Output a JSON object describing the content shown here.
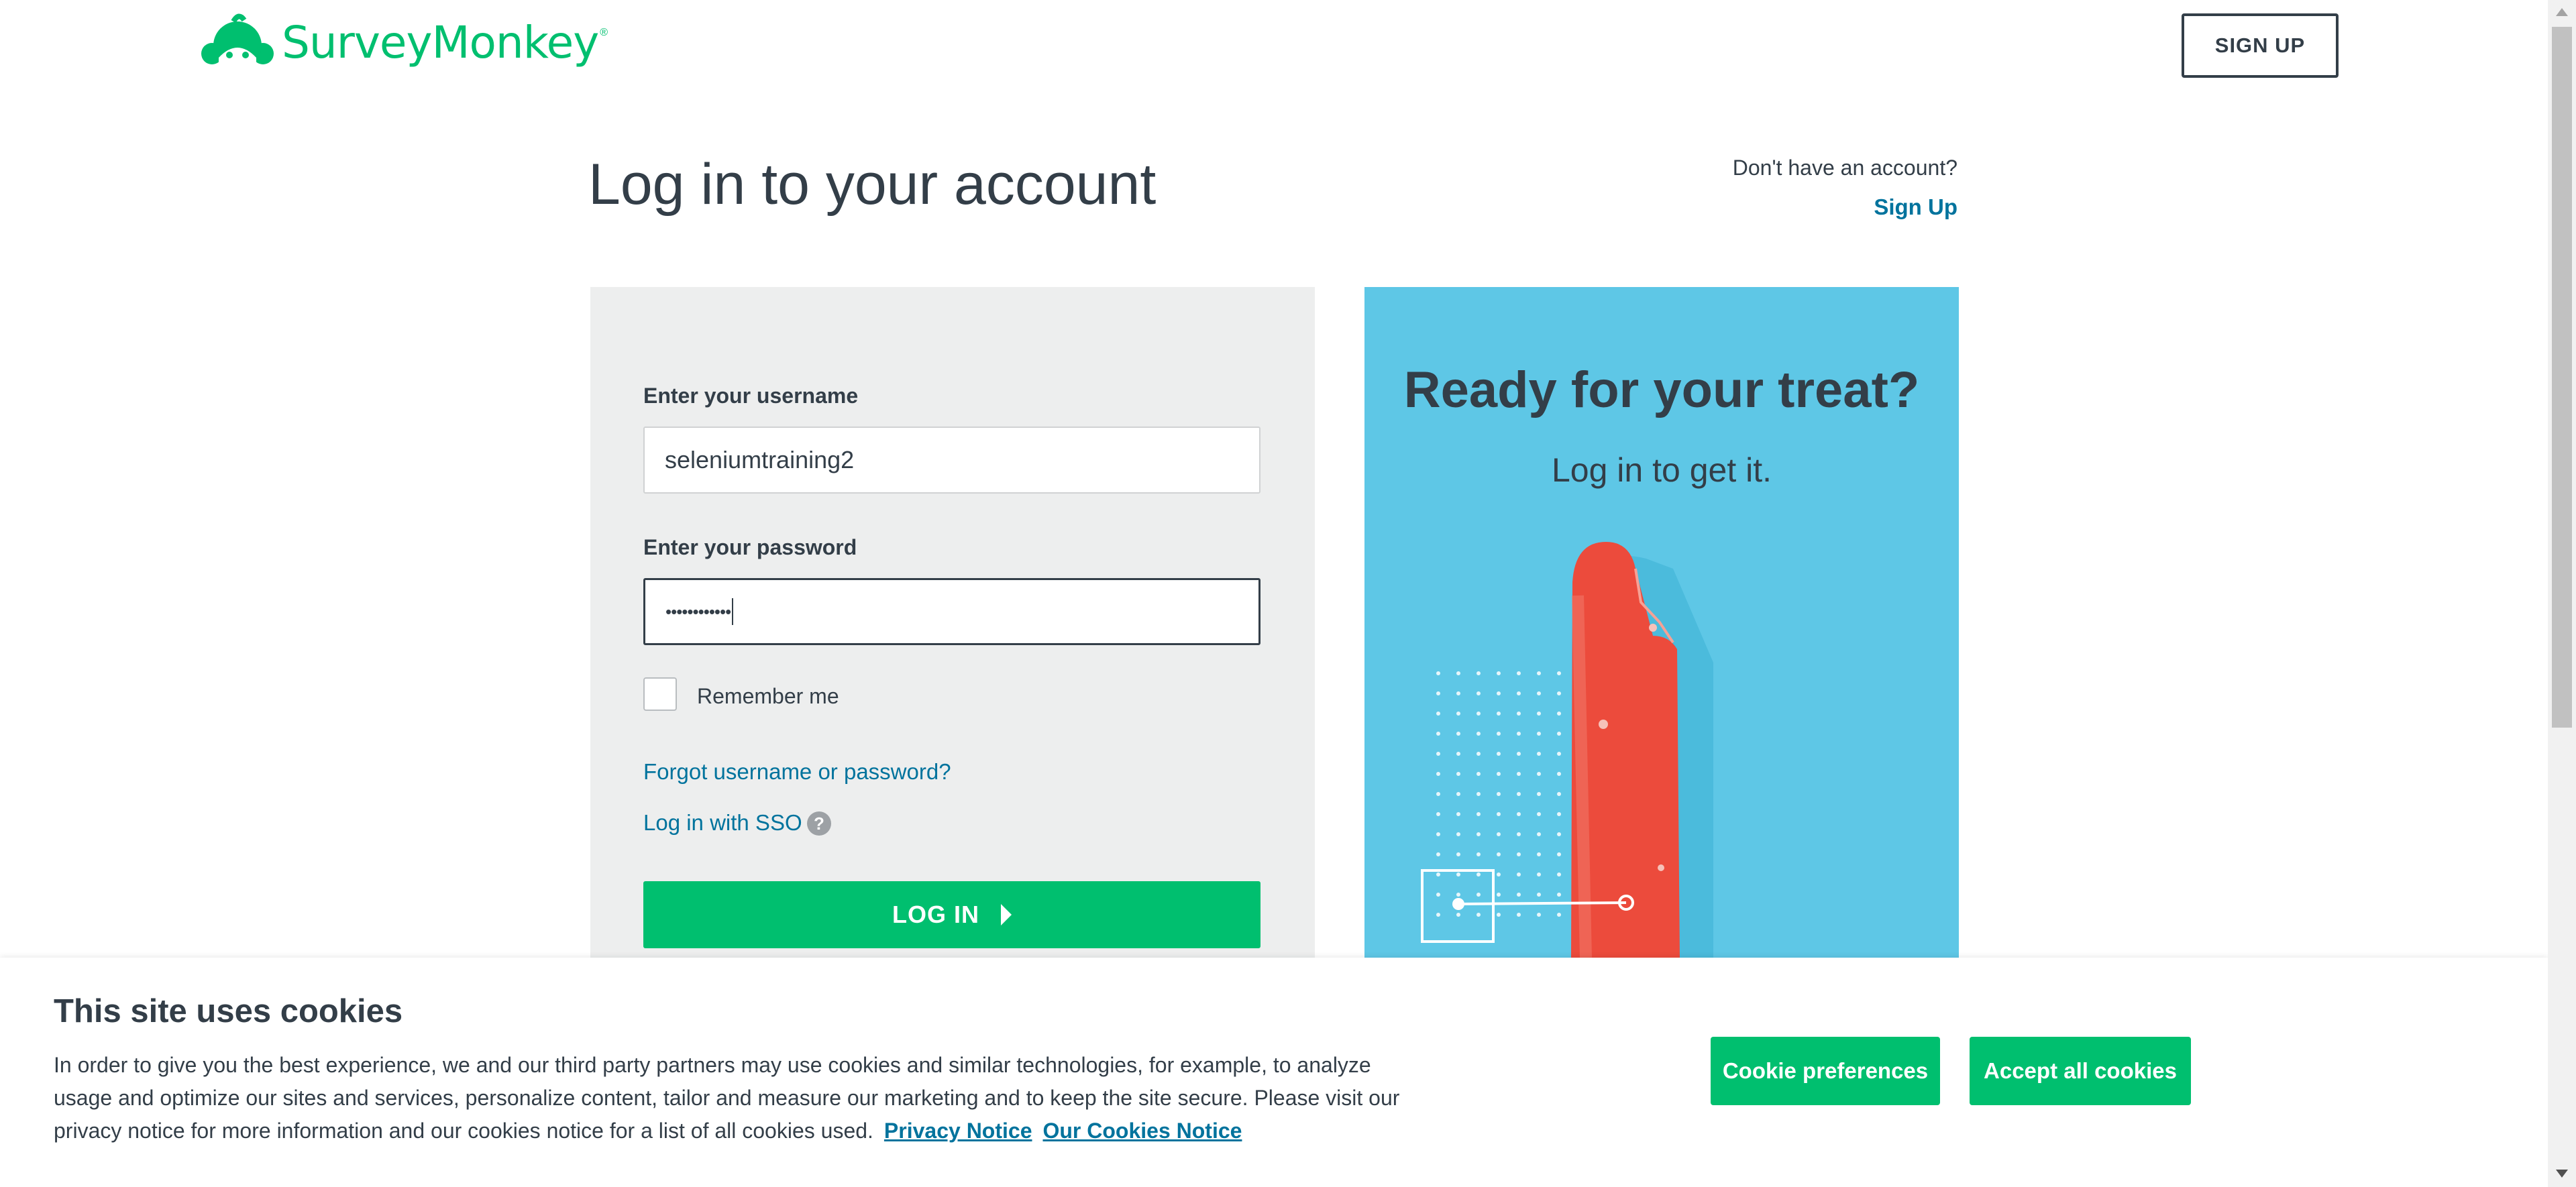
{
  "header": {
    "logo_text": "SurveyMonkey",
    "logo_mark": "®",
    "signup_button": "SIGN UP"
  },
  "main": {
    "title": "Log in to your account",
    "no_account_text": "Don't have an account?",
    "signup_link": "Sign Up"
  },
  "form": {
    "username_label": "Enter your username",
    "username_value": "seleniumtraining2",
    "password_label": "Enter your password",
    "password_masked": "••••••••••••",
    "remember_label": "Remember me",
    "forgot_link": "Forgot username or password?",
    "sso_link": "Log in with SSO",
    "sso_help_icon": "?",
    "login_button": "LOG IN"
  },
  "promo": {
    "title": "Ready for your treat?",
    "subtitle": "Log in to get it."
  },
  "cookie_banner": {
    "title": "This site uses cookies",
    "body": "In order to give you the best experience, we and our third party partners may use cookies and similar technologies, for example, to analyze usage and optimize our sites and services, personalize content, tailor and measure our marketing and to keep the site secure. Please visit our privacy notice for more information and our cookies notice for a list of all cookies used.",
    "privacy_link": "Privacy Notice",
    "cookies_link": "Our Cookies Notice",
    "preferences_button": "Cookie preferences",
    "accept_button": "Accept all cookies"
  },
  "colors": {
    "brand_green": "#00bf6f",
    "link_blue": "#00739d",
    "text_dark": "#333e48",
    "panel_gray": "#edeeee",
    "promo_blue": "#5ec7e6"
  }
}
